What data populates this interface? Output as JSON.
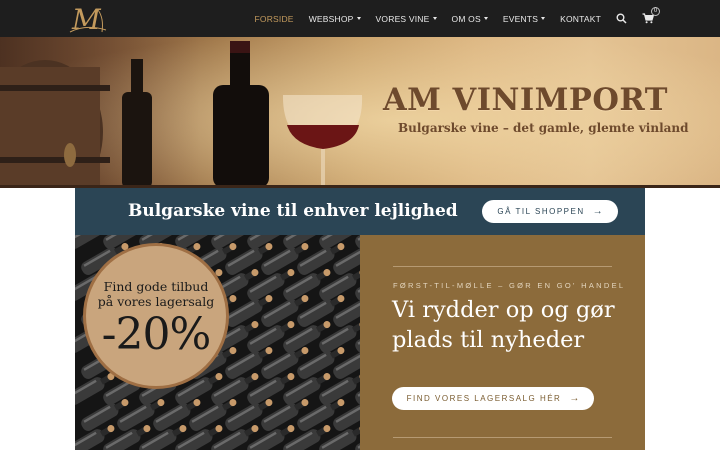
{
  "brand": {
    "logo_letter": "M"
  },
  "nav": {
    "items": [
      {
        "label": "FORSIDE",
        "active": true,
        "dropdown": false
      },
      {
        "label": "WEBSHOP",
        "active": false,
        "dropdown": true
      },
      {
        "label": "VORES VINE",
        "active": false,
        "dropdown": true
      },
      {
        "label": "OM OS",
        "active": false,
        "dropdown": true
      },
      {
        "label": "EVENTS",
        "active": false,
        "dropdown": true
      },
      {
        "label": "KONTAKT",
        "active": false,
        "dropdown": false
      }
    ],
    "search_icon": "search-icon",
    "cart_icon": "cart-icon",
    "cart_count": "0"
  },
  "hero": {
    "title": "AM VINIMPORT",
    "subtitle": "Bulgarske vine – det gamle, glemte vinland"
  },
  "banner": {
    "text": "Bulgarske vine til enhver lejlighed",
    "button_label": "GÅ TIL SHOPPEN",
    "button_arrow": "→"
  },
  "promo": {
    "badge_line1": "Find gode tilbud",
    "badge_line2": "på vores lagersalg",
    "badge_percent": "-20%",
    "kicker": "FØRST-TIL-MØLLE – GØR EN GO' HANDEL",
    "heading": "Vi rydder op og gør plads til nyheder",
    "button_label": "FIND VORES LAGERSALG HÉR",
    "button_arrow": "→"
  },
  "colors": {
    "header_bg": "#1e1e1e",
    "nav_active": "#c39a5d",
    "banner_bg": "#2b4555",
    "promo_panel_bg": "#8c6b3b",
    "badge_bg": "#c9a57d",
    "hero_title": "#6e4a2d"
  }
}
